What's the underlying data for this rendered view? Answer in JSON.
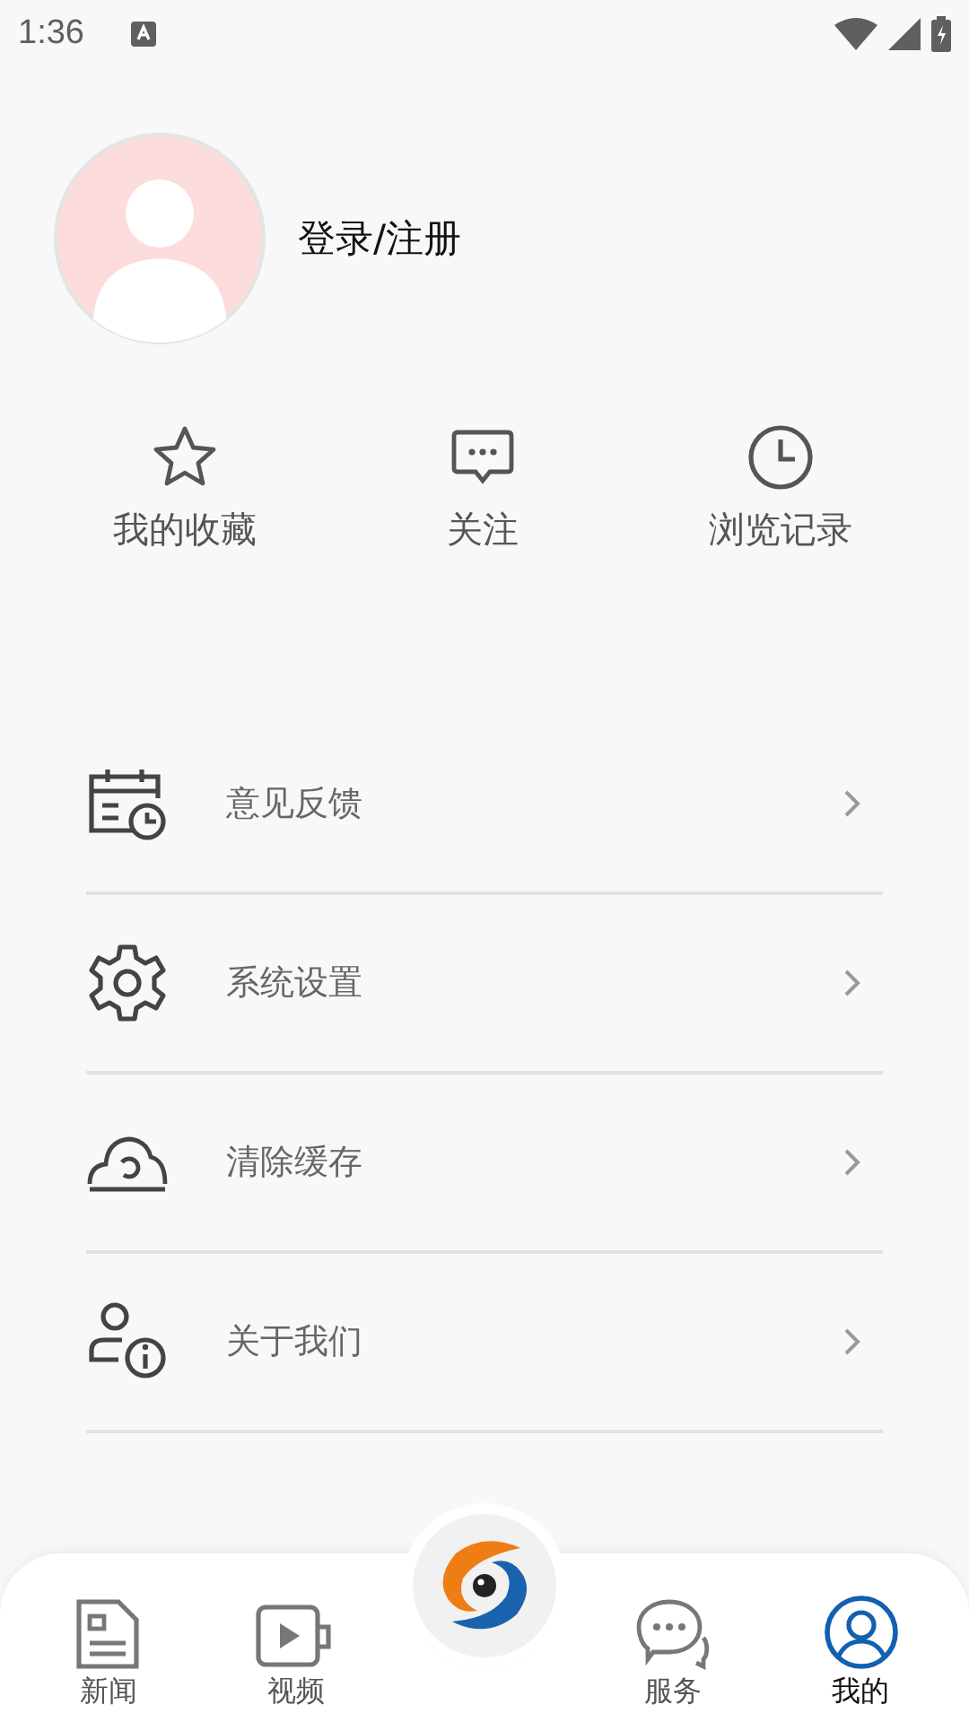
{
  "status_bar": {
    "time": "1:36"
  },
  "profile": {
    "login_label": "登录/注册"
  },
  "shortcuts": [
    {
      "kind": "star",
      "label": "我的收藏"
    },
    {
      "kind": "chat",
      "label": "关注"
    },
    {
      "kind": "clock",
      "label": "浏览记录"
    }
  ],
  "menu": [
    {
      "kind": "calendar",
      "label": "意见反馈"
    },
    {
      "kind": "gear",
      "label": "系统设置"
    },
    {
      "kind": "cloud",
      "label": "清除缓存"
    },
    {
      "kind": "about",
      "label": "关于我们"
    }
  ],
  "tab_bar": [
    {
      "kind": "news",
      "label": "新闻",
      "selected": false
    },
    {
      "kind": "video",
      "label": "视频",
      "selected": false
    },
    {
      "kind": "logo",
      "selected": false
    },
    {
      "kind": "service",
      "label": "服务",
      "selected": false
    },
    {
      "kind": "me",
      "label": "我的",
      "selected": true
    }
  ]
}
